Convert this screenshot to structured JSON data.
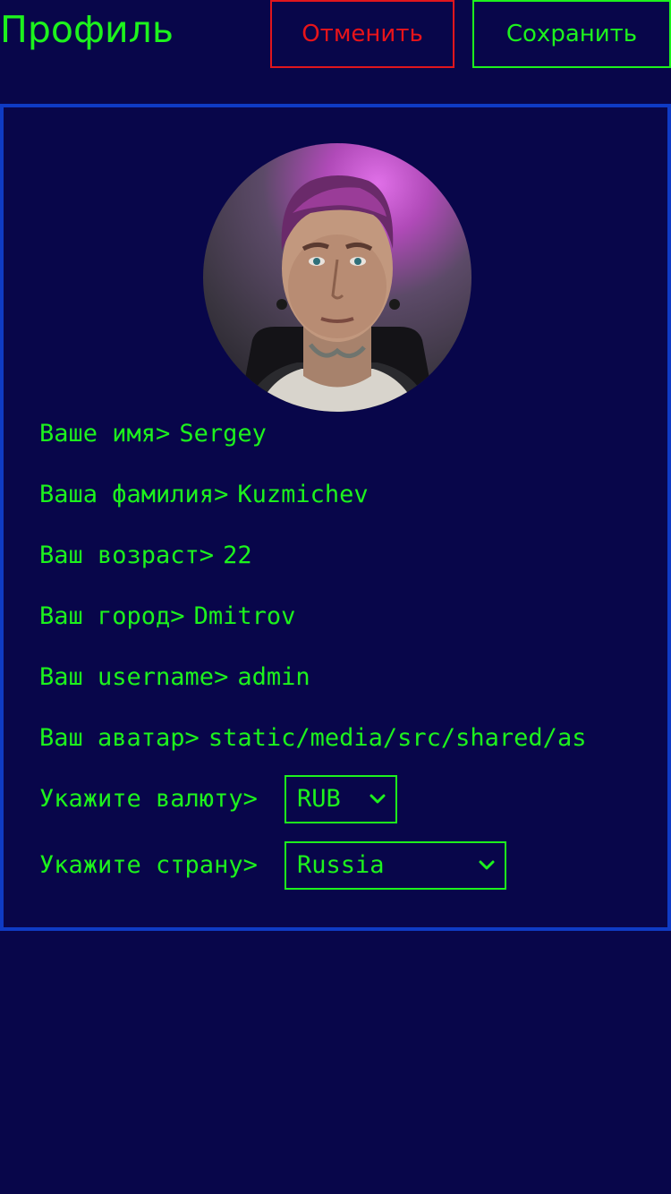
{
  "header": {
    "title": "Профиль",
    "cancel_label": "Отменить",
    "save_label": "Сохранить"
  },
  "profile": {
    "fields": [
      {
        "label": "Ваше имя>",
        "value": "Sergey"
      },
      {
        "label": "Ваша фамилия>",
        "value": "Kuzmichev"
      },
      {
        "label": "Ваш возраст>",
        "value": "22"
      },
      {
        "label": "Ваш город>",
        "value": "Dmitrov"
      },
      {
        "label": "Ваш username>",
        "value": "admin"
      },
      {
        "label": "Ваш аватар>",
        "value": "static/media/src/shared/as"
      }
    ],
    "currency": {
      "label": "Укажите валюту>",
      "selected": "RUB"
    },
    "country": {
      "label": "Укажите страну>",
      "selected": "Russia"
    }
  },
  "colors": {
    "background": "#08064a",
    "text": "#1df21d",
    "cancel": "#e8141a",
    "card_border": "#0f3bc4"
  },
  "icons": {
    "select_chevron": "chevron-down-icon"
  }
}
